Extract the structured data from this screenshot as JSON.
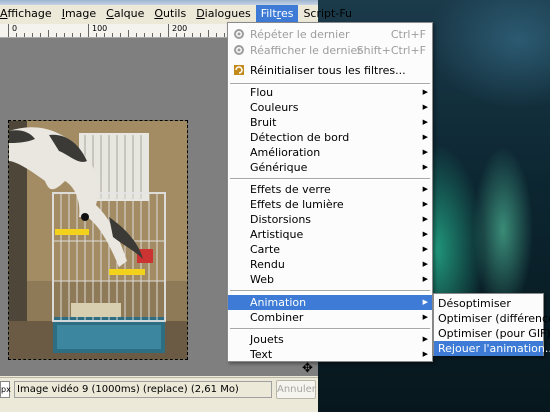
{
  "menubar": {
    "items": [
      {
        "label": "Affichage",
        "active": false
      },
      {
        "label": "Image",
        "active": false
      },
      {
        "label": "Calque",
        "active": false
      },
      {
        "label": "Outils",
        "active": false
      },
      {
        "label": "Dialogues",
        "active": false
      },
      {
        "label": "Filtres",
        "active": true
      },
      {
        "label": "Script-Fu",
        "active": false
      }
    ]
  },
  "ruler": {
    "labels": [
      "0",
      "100",
      "200"
    ]
  },
  "filters_menu": {
    "repeat_last": {
      "label": "Répéter le dernier",
      "shortcut": "Ctrl+F"
    },
    "reshow_last": {
      "label": "Réafficher le dernier",
      "shortcut": "Shift+Ctrl+F"
    },
    "reset_all": {
      "label": "Réinitialiser tous les filtres..."
    },
    "group1": [
      "Flou",
      "Couleurs",
      "Bruit",
      "Détection de bord",
      "Amélioration",
      "Générique"
    ],
    "group2": [
      "Effets de verre",
      "Effets de lumière",
      "Distorsions",
      "Artistique",
      "Carte",
      "Rendu",
      "Web"
    ],
    "group3": [
      "Animation",
      "Combiner"
    ],
    "group4": [
      "Jouets",
      "Text"
    ]
  },
  "animation_submenu": {
    "items": [
      "Désoptimiser",
      "Optimiser (différence)",
      "Optimiser (pour GIF)",
      "Rejouer l'animation..."
    ],
    "highlighted_index": 3
  },
  "statusbar": {
    "unit": "px",
    "text": "Image vidéo 9 (1000ms) (replace) (2,61 Mo)",
    "cancel_label": "Annuler"
  },
  "colors": {
    "highlight": "#3d7bd6"
  }
}
